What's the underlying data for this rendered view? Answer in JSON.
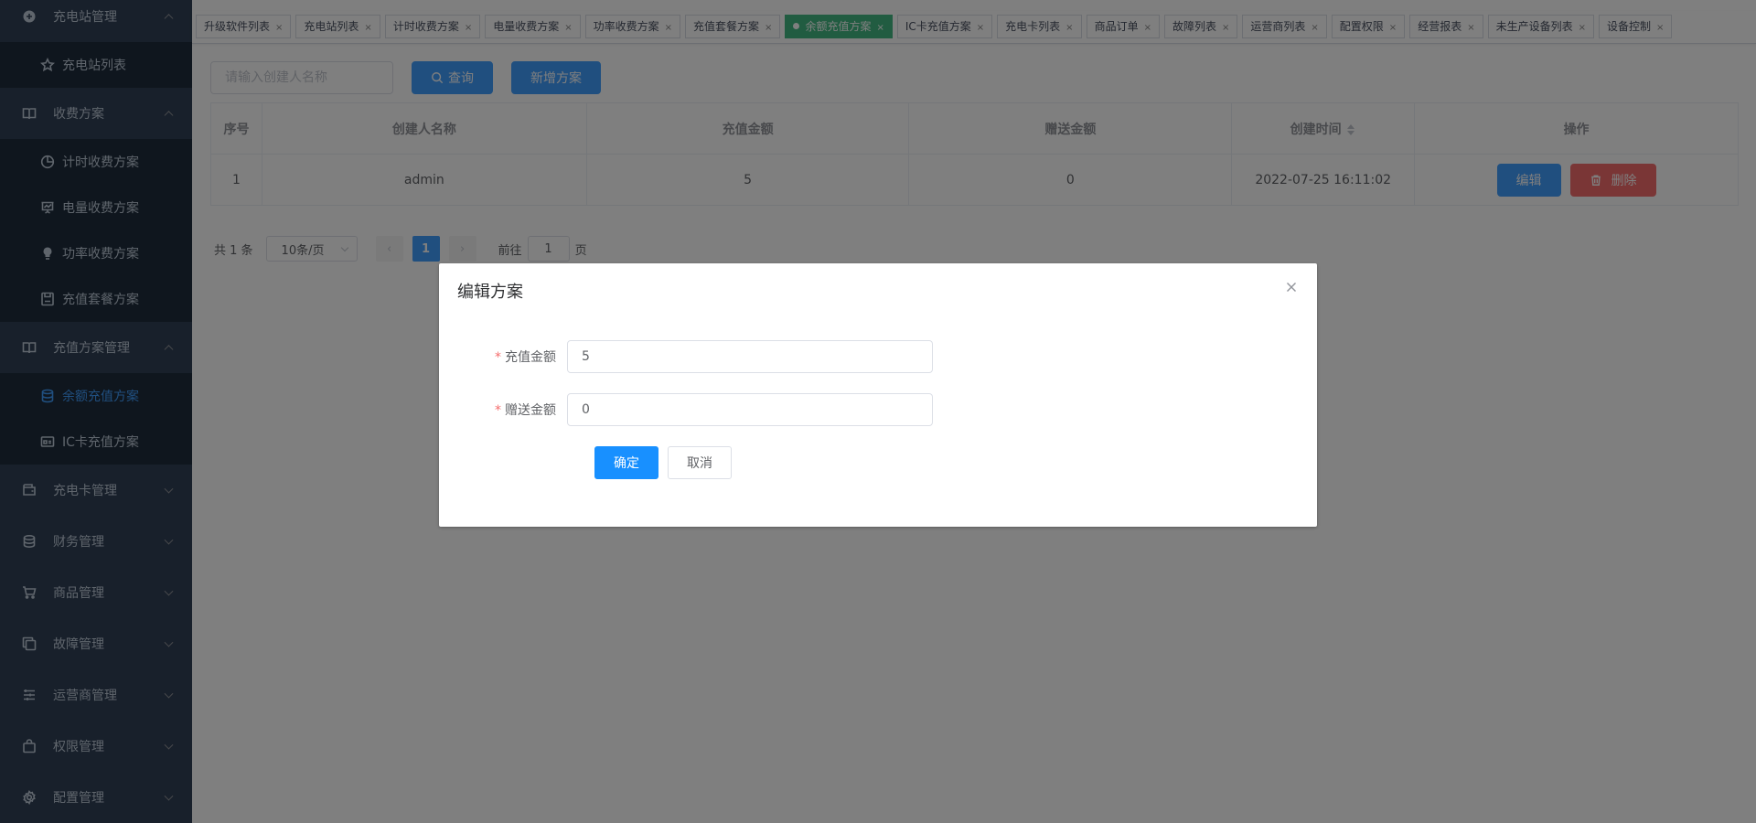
{
  "sidebar": {
    "groups": [
      {
        "label": "充电站管理",
        "icon": "circle-plus-icon",
        "expanded": true,
        "items": [
          {
            "label": "充电站列表",
            "icon": "star-icon"
          }
        ]
      },
      {
        "label": "收费方案",
        "icon": "book-icon",
        "expanded": true,
        "items": [
          {
            "label": "计时收费方案",
            "icon": "pie-chart-icon"
          },
          {
            "label": "电量收费方案",
            "icon": "presentation-icon"
          },
          {
            "label": "功率收费方案",
            "icon": "lightbulb-icon"
          },
          {
            "label": "充值套餐方案",
            "icon": "save-icon"
          }
        ]
      },
      {
        "label": "充值方案管理",
        "icon": "book-icon",
        "expanded": true,
        "items": [
          {
            "label": "余额充值方案",
            "icon": "database-icon",
            "active": true
          },
          {
            "label": "IC卡充值方案",
            "icon": "card-icon"
          }
        ]
      },
      {
        "label": "充电卡管理",
        "icon": "wallet-icon"
      },
      {
        "label": "财务管理",
        "icon": "coins-icon"
      },
      {
        "label": "商品管理",
        "icon": "cart-icon"
      },
      {
        "label": "故障管理",
        "icon": "copy-icon"
      },
      {
        "label": "运营商管理",
        "icon": "list-icon"
      },
      {
        "label": "权限管理",
        "icon": "bag-icon"
      },
      {
        "label": "配置管理",
        "icon": "gear-icon"
      }
    ]
  },
  "tags": [
    {
      "label": "升级软件列表"
    },
    {
      "label": "充电站列表"
    },
    {
      "label": "计时收费方案"
    },
    {
      "label": "电量收费方案"
    },
    {
      "label": "功率收费方案"
    },
    {
      "label": "充值套餐方案"
    },
    {
      "label": "余额充值方案",
      "active": true
    },
    {
      "label": "IC卡充值方案"
    },
    {
      "label": "充电卡列表"
    },
    {
      "label": "商品订单"
    },
    {
      "label": "故障列表"
    },
    {
      "label": "运营商列表"
    },
    {
      "label": "配置权限"
    },
    {
      "label": "经营报表"
    },
    {
      "label": "未生产设备列表"
    },
    {
      "label": "设备控制"
    }
  ],
  "toolbar": {
    "search_placeholder": "请输入创建人名称",
    "query_label": "查询",
    "add_label": "新增方案"
  },
  "table": {
    "headers": [
      "序号",
      "创建人名称",
      "充值金额",
      "赠送金额",
      "创建时间",
      "操作"
    ],
    "rows": [
      {
        "index": "1",
        "creator": "admin",
        "amount": "5",
        "bonus": "0",
        "created": "2022-07-25 16:11:02"
      }
    ],
    "edit_label": "编辑",
    "delete_label": "删除"
  },
  "pagination": {
    "total": "共 1 条",
    "page_size": "10条/页",
    "prev": "‹",
    "current": "1",
    "next": "›",
    "goto_prefix": "前往",
    "goto_value": "1",
    "goto_suffix": "页"
  },
  "dialog": {
    "title": "编辑方案",
    "close": "×",
    "fields": [
      {
        "label": "充值金额",
        "value": "5",
        "required": "*"
      },
      {
        "label": "赠送金额",
        "value": "0",
        "required": "*"
      }
    ],
    "confirm_label": "确定",
    "cancel_label": "取消"
  }
}
